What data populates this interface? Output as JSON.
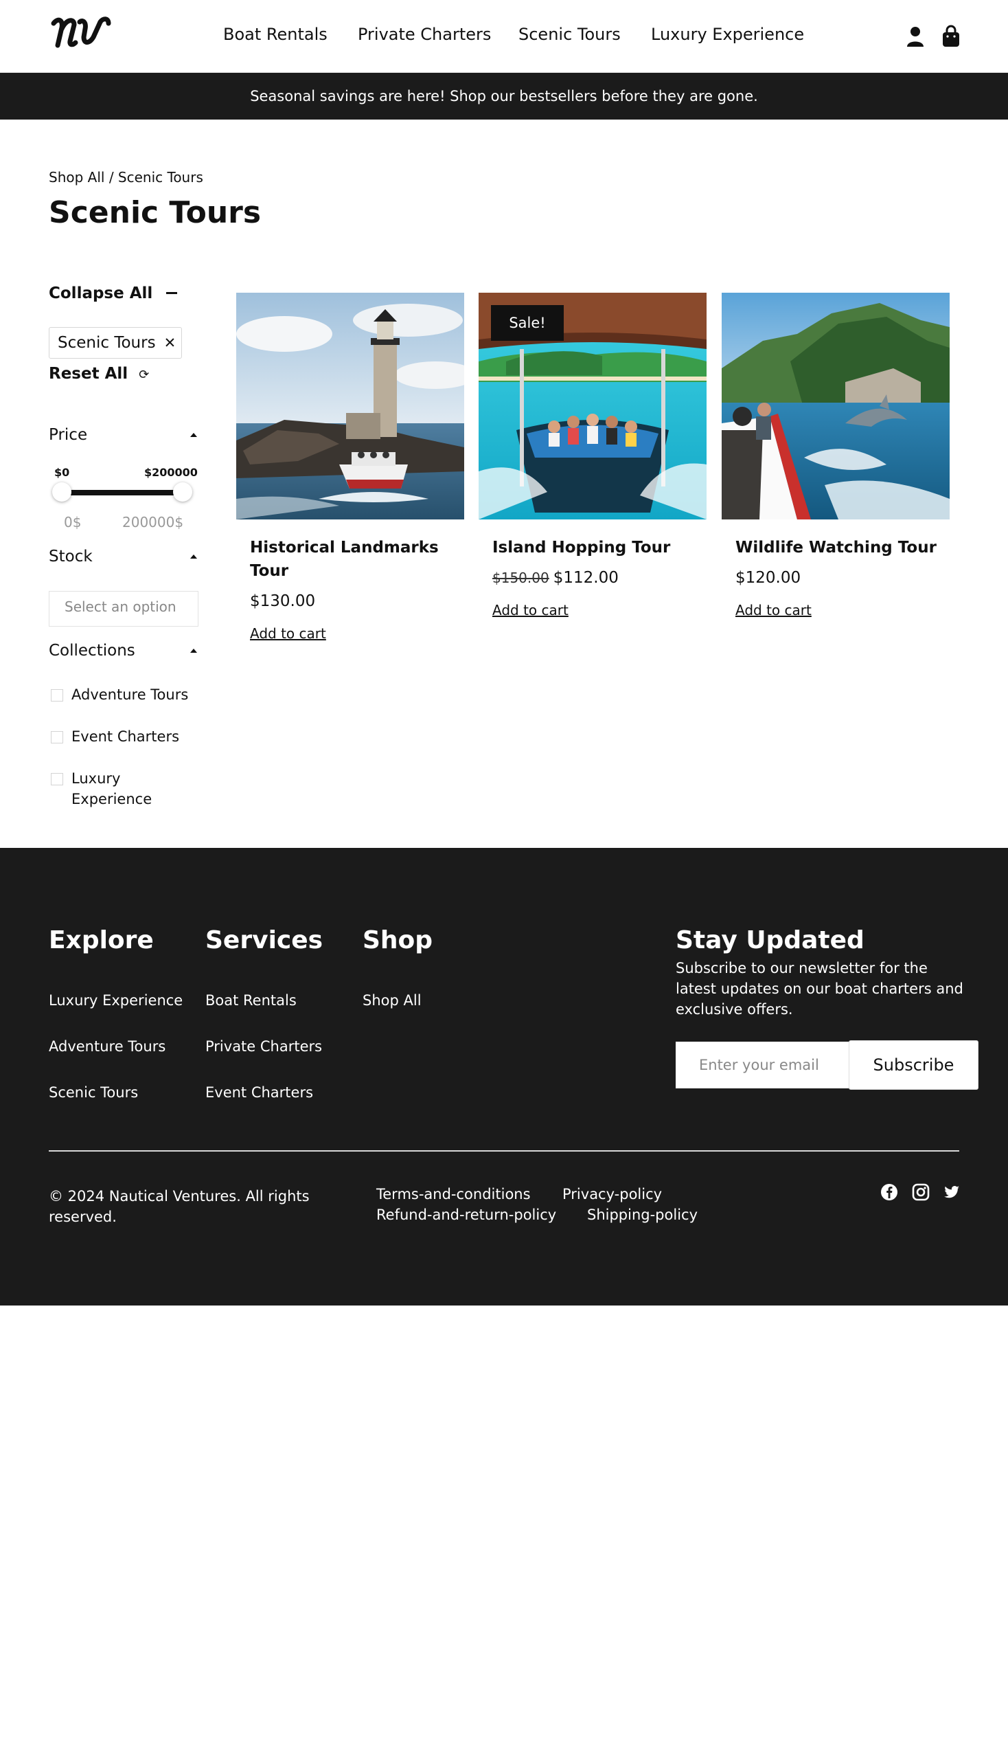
{
  "header": {
    "logo_text": "NV",
    "nav": [
      "Boat Rentals",
      "Private Charters",
      "Scenic Tours",
      "Luxury Experience"
    ],
    "icons": [
      "user-icon",
      "bag-icon"
    ]
  },
  "announcement": "Seasonal savings are here! Shop our bestsellers before they are gone.",
  "breadcrumb": {
    "parent": "Shop All",
    "separator": " / ",
    "current": "Scenic Tours"
  },
  "page_title": "Scenic Tours",
  "filters": {
    "collapse_all": "Collapse All",
    "active_chip": "Scenic Tours",
    "reset_all": "Reset All",
    "price": {
      "title": "Price",
      "min_label": "$0",
      "max_label": "$200000",
      "min_value": "0$",
      "max_value": "200000$",
      "range_min_fraction": 0,
      "range_max_fraction": 1
    },
    "stock": {
      "title": "Stock",
      "placeholder": "Select an option"
    },
    "collections": {
      "title": "Collections",
      "items": [
        "Adventure Tours",
        "Event Charters",
        "Luxury Experience"
      ]
    }
  },
  "products": [
    {
      "name": "Historical Landmarks Tour",
      "price": "$130.00",
      "old_price": "",
      "sale_badge": "",
      "add_to_cart": "Add to cart"
    },
    {
      "name": "Island Hopping Tour",
      "price": "$112.00",
      "old_price": "$150.00",
      "sale_badge": "Sale!",
      "add_to_cart": "Add to cart"
    },
    {
      "name": "Wildlife Watching Tour",
      "price": "$120.00",
      "old_price": "",
      "sale_badge": "",
      "add_to_cart": "Add to cart"
    }
  ],
  "footer": {
    "explore": {
      "title": "Explore",
      "links": [
        "Luxury Experience",
        "Adventure Tours",
        "Scenic Tours"
      ]
    },
    "services": {
      "title": "Services",
      "links": [
        "Boat Rentals",
        "Private Charters",
        "Event Charters"
      ]
    },
    "shop": {
      "title": "Shop",
      "links": [
        "Shop All"
      ]
    },
    "newsletter": {
      "title": "Stay Updated",
      "text": "Subscribe to our newsletter for the latest updates on our boat charters and exclusive offers.",
      "placeholder": "Enter your email",
      "button": "Subscribe"
    },
    "copyright": "© 2024 Nautical Ventures. All rights reserved.",
    "policies": [
      "Terms-and-conditions",
      "Privacy-policy",
      "Refund-and-return-policy",
      "Shipping-policy"
    ],
    "social_icons": [
      "facebook-icon",
      "instagram-icon",
      "twitter-icon"
    ]
  },
  "colors": {
    "dark": "#1b1b1b",
    "text": "#111111",
    "muted": "#888888"
  }
}
